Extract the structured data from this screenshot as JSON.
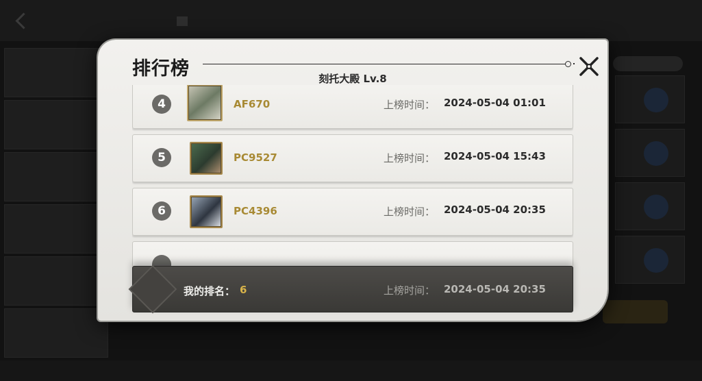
{
  "popup": {
    "title": "排行榜",
    "subtitle": "刻托大殿 Lv.8",
    "close_icon": "close-x-icon"
  },
  "rankings": [
    {
      "rank": "4",
      "name": "AF670",
      "time_label": "上榜时间：",
      "time": "2024-05-04 01:01",
      "avatar": "ornate-hero-avatar"
    },
    {
      "rank": "5",
      "name": "PC9527",
      "time_label": "上榜时间：",
      "time": "2024-05-04 15:43",
      "avatar": "hero-avatar"
    },
    {
      "rank": "6",
      "name": "PC4396",
      "time_label": "上榜时间：",
      "time": "2024-05-04 20:35",
      "avatar": "hero-avatar"
    }
  ],
  "my_rank": {
    "label": "我的排名：",
    "value": "6",
    "time_label": "上榜时间：",
    "time": "2024-05-04 20:35"
  },
  "colors": {
    "panel_bg": "#efeeeb",
    "name_gold": "#a88a34",
    "my_rank_gold": "#d9b44a",
    "my_bar_bg": "#45433f"
  }
}
